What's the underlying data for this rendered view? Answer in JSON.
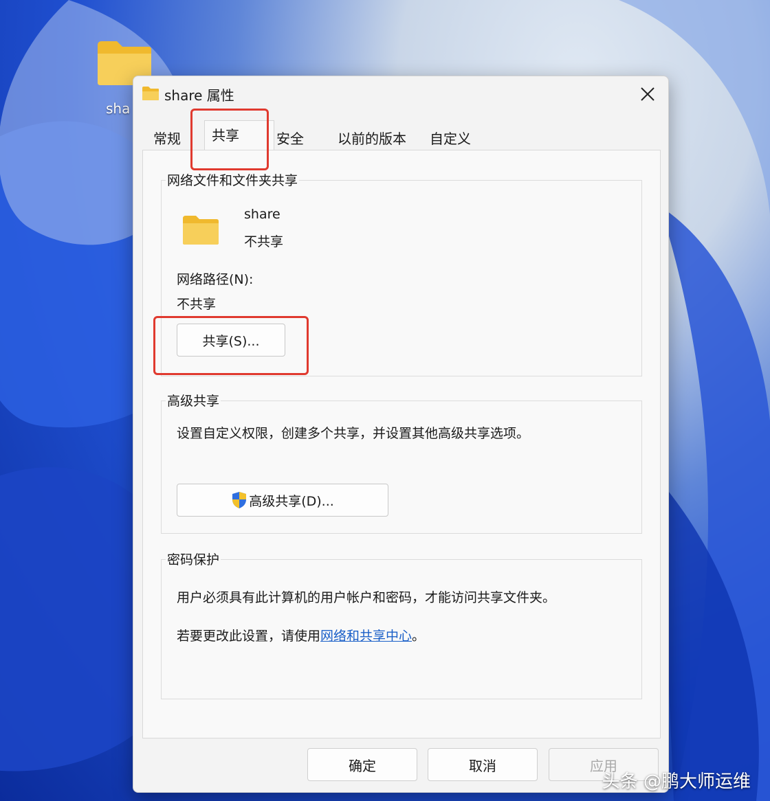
{
  "desktop": {
    "icon_label": "sha"
  },
  "dialog": {
    "title": "share 属性",
    "tabs": [
      {
        "label": "常规"
      },
      {
        "label": "共享"
      },
      {
        "label": "安全"
      },
      {
        "label": "以前的版本"
      },
      {
        "label": "自定义"
      }
    ],
    "active_tab": "共享",
    "network_sharing": {
      "group_title": "网络文件和文件夹共享",
      "folder_name": "share",
      "folder_status": "不共享",
      "path_label": "网络路径(N):",
      "path_value": "不共享",
      "share_button": "共享(S)..."
    },
    "advanced_sharing": {
      "group_title": "高级共享",
      "description": "设置自定义权限，创建多个共享，并设置其他高级共享选项。",
      "button": "高级共享(D)..."
    },
    "password_protection": {
      "group_title": "密码保护",
      "description": "用户必须具有此计算机的用户帐户和密码，才能访问共享文件夹。",
      "change_prefix": "若要更改此设置，请使用",
      "link": "网络和共享中心",
      "change_suffix": "。"
    },
    "footer": {
      "ok": "确定",
      "cancel": "取消",
      "apply": "应用"
    }
  },
  "watermark": "头条 @鹏大师运维",
  "colors": {
    "highlight": "#e03a2f",
    "link": "#1a5fc8",
    "folder": "#f5c84a"
  }
}
